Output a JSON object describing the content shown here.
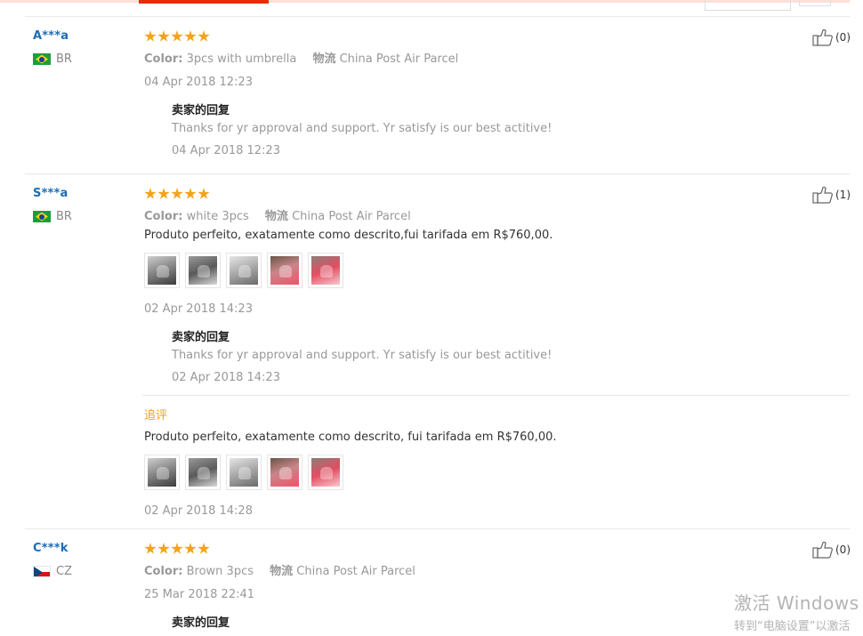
{
  "reviews": [
    {
      "user": "A***a",
      "country": "BR",
      "stars": 5,
      "color_label": "Color:",
      "color_value": "3pcs with umbrella",
      "shipping_label": "物流",
      "shipping_value": "China Post Air Parcel",
      "date": "04 Apr 2018 12:23",
      "reply_title": "卖家的回复",
      "reply_text": "Thanks for yr approval and support. Yr satisfy is our best actitive!",
      "reply_date": "04 Apr 2018 12:23",
      "likes": "(0)"
    },
    {
      "user": "S***a",
      "country": "BR",
      "stars": 5,
      "color_label": "Color:",
      "color_value": "white 3pcs",
      "shipping_label": "物流",
      "shipping_value": "China Post Air Parcel",
      "text": "Produto perfeito, exatamente como descrito,fui tarifada em R$760,00.",
      "date": "02 Apr 2018 14:23",
      "reply_title": "卖家的回复",
      "reply_text": "Thanks for yr approval and support. Yr satisfy is our best actitive!",
      "reply_date": "02 Apr 2018 14:23",
      "followup_label": "追评",
      "followup_text": "Produto perfeito, exatamente como descrito, fui tarifada em R$760,00.",
      "followup_date": "02 Apr 2018 14:28",
      "likes": "(1)"
    },
    {
      "user": "C***k",
      "country": "CZ",
      "stars": 5,
      "color_label": "Color:",
      "color_value": "Brown 3pcs",
      "shipping_label": "物流",
      "shipping_value": "China Post Air Parcel",
      "date": "25 Mar 2018 22:41",
      "reply_title": "卖家的回复",
      "likes": "(0)"
    }
  ],
  "colors": {
    "accent": "#e62e04",
    "star": "#f4a31a",
    "username": "#1d6cb5",
    "followup": "#f0a020"
  },
  "watermark": {
    "line1": "激活 Windows",
    "line2": "转到“电脑设置”以激活"
  }
}
